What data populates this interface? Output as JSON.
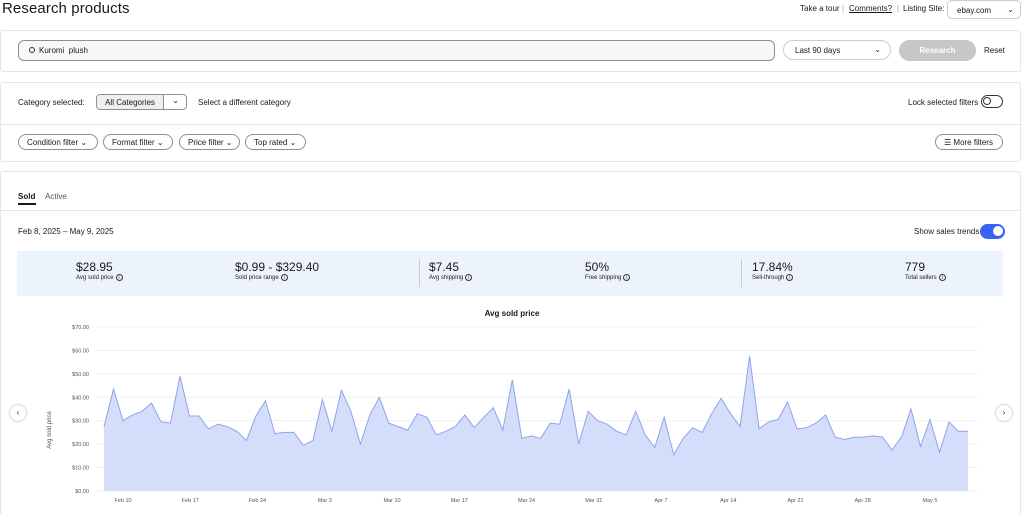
{
  "header": {
    "title": "Research products",
    "take_tour": "Take a tour",
    "comments": "Comments?",
    "listing_site_label": "Listing Site:",
    "listing_site_value": "ebay.com"
  },
  "search": {
    "query": "Kuromi  plush",
    "date_range": "Last 90 days",
    "research_label": "Research",
    "reset_label": "Reset"
  },
  "filters": {
    "category_label": "Category selected:",
    "category_value": "All Categories",
    "different_category": "Select a different category",
    "lock_label": "Lock selected filters",
    "pills": [
      "Condition filter",
      "Format filter",
      "Price filter",
      "Top rated"
    ],
    "more_filters": "More filters"
  },
  "tabs": {
    "sold": "Sold",
    "active": "Active"
  },
  "summary": {
    "date_range": "Feb 8, 2025 – May 9, 2025",
    "show_trends": "Show sales trends",
    "stats": [
      {
        "value": "$28.95",
        "label": "Avg sold price"
      },
      {
        "value": "$0.99 - $329.40",
        "label": "Sold price range"
      },
      {
        "value": "$7.45",
        "label": "Avg shipping"
      },
      {
        "value": "50%",
        "label": "Free shipping"
      },
      {
        "value": "17.84%",
        "label": "Sell-through"
      },
      {
        "value": "779",
        "label": "Total sellers"
      }
    ]
  },
  "colors": {
    "accent": "#3665f3",
    "area_fill": "#d4defb",
    "line": "#8ea4ea",
    "stats_bg": "#edf3fc"
  },
  "chart_data": {
    "type": "area",
    "title": "Avg sold price",
    "ylabel": "Avg sold price",
    "xlabel": "",
    "ylim": [
      0,
      70
    ],
    "yticks": [
      "$0.00",
      "$10.00",
      "$20.00",
      "$30.00",
      "$40.00",
      "$50.00",
      "$60.00",
      "$70.00"
    ],
    "xticks": [
      "Feb 10",
      "Feb 17",
      "Feb 24",
      "Mar 3",
      "Mar 10",
      "Mar 17",
      "Mar 24",
      "Mar 31",
      "Apr 7",
      "Apr 14",
      "Apr 21",
      "Apr 28",
      "May 5"
    ],
    "grid": true,
    "values": [
      27.5,
      43.5,
      30,
      32.5,
      34,
      37.5,
      29.5,
      29,
      49,
      32,
      32,
      26.5,
      28.5,
      27.5,
      25.5,
      21.5,
      32,
      38.5,
      24.5,
      25,
      25,
      19.5,
      21.5,
      39,
      25.5,
      43,
      34,
      20,
      32.5,
      40,
      29,
      27.5,
      26,
      33,
      31.5,
      24,
      25.5,
      27.5,
      32.5,
      27,
      31.5,
      35.5,
      26,
      47.5,
      22.5,
      23.5,
      22.5,
      29,
      28.5,
      43.5,
      20,
      34,
      30,
      28.5,
      25.5,
      24,
      34,
      24,
      18.5,
      31.5,
      15.5,
      22.5,
      27,
      25,
      33,
      39.5,
      33,
      27.5,
      57.5,
      26.5,
      29.5,
      30.5,
      38,
      26.5,
      27,
      29,
      32.5,
      23,
      22,
      23,
      23,
      23.5,
      23,
      17.5,
      23,
      35,
      19,
      30.5,
      16.5,
      29.5,
      25.5,
      25.5
    ]
  }
}
